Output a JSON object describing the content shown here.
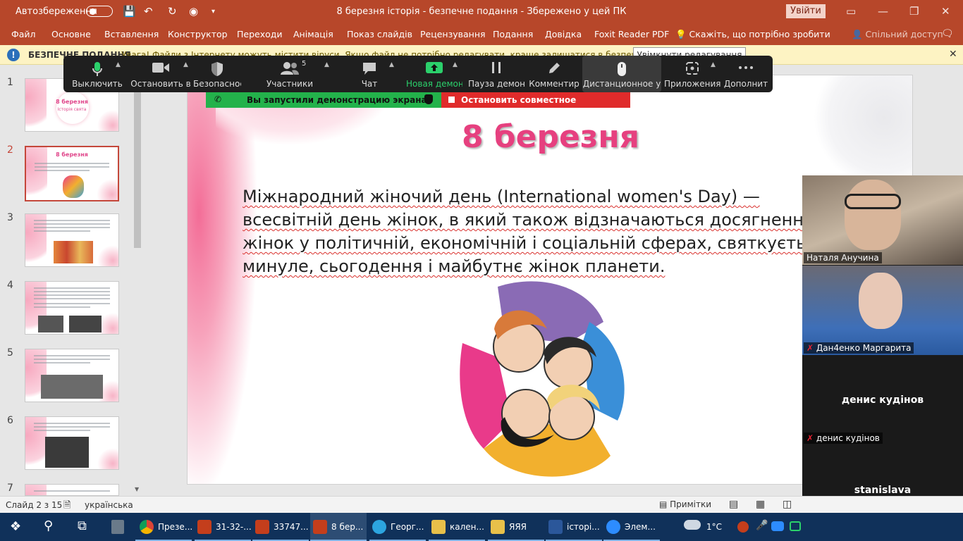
{
  "titlebar": {
    "autosave_label": "Автозбереження",
    "doc_title": "8 березня історія  -  безпечне подання  -  Збережено у цей ПК",
    "signin_label": "Увійти"
  },
  "ribbon": {
    "tabs": [
      "Файл",
      "Основне",
      "Вставлення",
      "Конструктор",
      "Переходи",
      "Анімація",
      "Показ слайдів",
      "Рецензування",
      "Подання",
      "Довідка",
      "Foxit Reader PDF"
    ],
    "tell_me": "Скажіть, що потрібно зробити",
    "share": "Спільний доступ"
  },
  "security_bar": {
    "title": "БЕЗПЕЧНЕ ПОДАННЯ",
    "message": "Увага! Файли з Інтернету можуть містити віруси. Якщо файл не потрібно редагувати, краще залишатися в безпечному поданні.",
    "enable_button": "Увімкнути редагування"
  },
  "slides_panel": {
    "numbers": [
      "1",
      "2",
      "3",
      "4",
      "5",
      "6",
      "7"
    ],
    "thumb1_title": "8 березня",
    "thumb1_sub": "Історія свята",
    "thumb2_title": "8 березня"
  },
  "slide": {
    "title": "8 березня",
    "body_lines": [
      "Міжнародний жіночий день (International women's Day) —",
      "всесвітній день жінок, в який також відзначаються досягнення",
      "жінок у політичній, економічній і соціальній сферах, святкується",
      "минуле, сьогодення і майбутнє жінок планети."
    ]
  },
  "zoom_toolbar": {
    "buttons": [
      "Выключить",
      "Остановить в",
      "Безопаснос",
      "Участники",
      "Чат",
      "Новая демон",
      "Пауза демон",
      "Комментир",
      "Дистанционное у",
      "Приложения",
      "Дополнит"
    ],
    "participants_count": "5",
    "share_started": "Вы запустили демонстрацию экрана",
    "stop_share": "Остановить совместное использование",
    "accent_green": "#23b24b",
    "stop_red": "#e02b2b"
  },
  "video_panel": {
    "participants": [
      "Наталя Анучина",
      "Дан4енко Маргарита",
      "денис кудінов",
      "stanislava"
    ]
  },
  "statusbar": {
    "slide_info": "Слайд 2 з 15",
    "language": "українська",
    "notes": "Примітки"
  },
  "taskbar": {
    "items": [
      "Презе...",
      "31-32-...",
      "33747...",
      "8 бер...",
      "Георг...",
      "кален...",
      "ЯЯЯ",
      "історі...",
      "Элем..."
    ],
    "weather": "1°C"
  }
}
